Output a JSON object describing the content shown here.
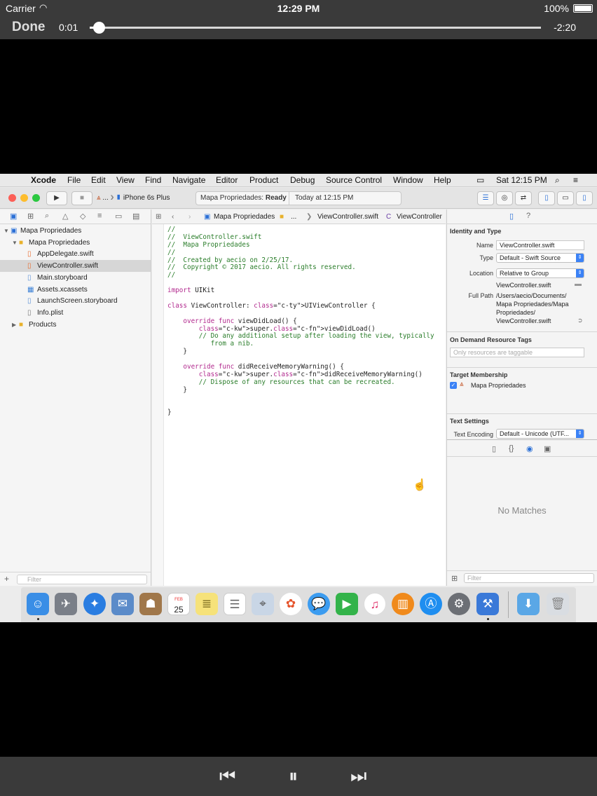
{
  "status_bar": {
    "carrier": "Carrier",
    "time": "12:29 PM",
    "battery": "100%"
  },
  "player": {
    "done_label": "Done",
    "elapsed": "0:01",
    "remaining": "-2:20",
    "progress": 0.02
  },
  "menubar": {
    "app": "Xcode",
    "items": [
      "File",
      "Edit",
      "View",
      "Find",
      "Navigate",
      "Editor",
      "Product",
      "Debug",
      "Source Control",
      "Window",
      "Help"
    ],
    "clock": "Sat 12:15 PM"
  },
  "toolbar": {
    "scheme_app": "...",
    "scheme_device": "iPhone 6s Plus",
    "activity_project": "Mapa Propriedades:",
    "activity_status": "Ready",
    "activity_time": "Today at 12:15 PM"
  },
  "navigator": {
    "filter_placeholder": "Filter",
    "tree": [
      {
        "label": "Mapa Propriedades",
        "kind": "project",
        "level": 0
      },
      {
        "label": "Mapa Propriedades",
        "kind": "folder",
        "level": 1
      },
      {
        "label": "AppDelegate.swift",
        "kind": "swift",
        "level": 2
      },
      {
        "label": "ViewController.swift",
        "kind": "swift",
        "level": 2
      },
      {
        "label": "Main.storyboard",
        "kind": "storyboard",
        "level": 2
      },
      {
        "label": "Assets.xcassets",
        "kind": "assets",
        "level": 2
      },
      {
        "label": "LaunchScreen.storyboard",
        "kind": "storyboard",
        "level": 2
      },
      {
        "label": "Info.plist",
        "kind": "plist",
        "level": 2
      },
      {
        "label": "Products",
        "kind": "folder",
        "level": 1
      }
    ]
  },
  "editor": {
    "jump_bar": [
      "Mapa Propriedades",
      "...",
      "ViewController.swift",
      "ViewController"
    ],
    "code": [
      "//",
      "//  ViewController.swift",
      "//  Mapa Propriedades",
      "//",
      "//  Created by aecio on 2/25/17.",
      "//  Copyright © 2017 aecio. All rights reserved.",
      "//",
      "",
      "import UIKit",
      "",
      "class ViewController: UIViewController {",
      "",
      "    override func viewDidLoad() {",
      "        super.viewDidLoad()",
      "        // Do any additional setup after loading the view, typically",
      "           from a nib.",
      "    }",
      "",
      "    override func didReceiveMemoryWarning() {",
      "        super.didReceiveMemoryWarning()",
      "        // Dispose of any resources that can be recreated.",
      "    }",
      "",
      "",
      "}"
    ]
  },
  "inspector": {
    "identity_title": "Identity and Type",
    "name_label": "Name",
    "name_value": "ViewController.swift",
    "type_label": "Type",
    "type_value": "Default - Swift Source",
    "location_label": "Location",
    "location_value": "Relative to Group",
    "location_file": "ViewController.swift",
    "fullpath_label": "Full Path",
    "fullpath_lines": [
      "/Users/aecio/Documents/",
      "Mapa Propriedades/Mapa",
      "Propriedades/",
      "ViewController.swift"
    ],
    "odr_title": "On Demand Resource Tags",
    "odr_placeholder": "Only resources are taggable",
    "target_title": "Target Membership",
    "target_name": "Mapa Propriedades",
    "text_title": "Text Settings",
    "encoding_label": "Text Encoding",
    "encoding_value": "Default - Unicode (UTF...",
    "no_matches": "No Matches",
    "filter_placeholder": "Filter"
  },
  "dock": {
    "date_month": "FEB",
    "date_day": "25"
  },
  "colors": {
    "accent": "#3b82f6",
    "bar": "#3a3a3a"
  }
}
